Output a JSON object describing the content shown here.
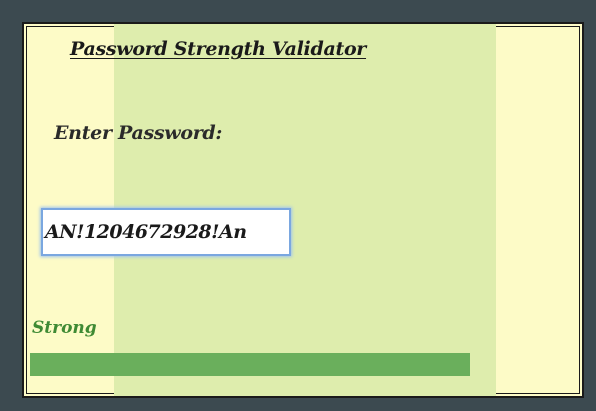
{
  "app": {
    "title": "Password Strength Validator"
  },
  "form": {
    "label": "Enter Password:",
    "password_value": "AN!1204672928!An"
  },
  "strength": {
    "text": "Strong",
    "level_fraction": 1.0,
    "bar_color": "#6aaf5c",
    "text_color": "#3f8a34"
  },
  "colors": {
    "background_outer": "#3c4a50",
    "panel_side": "#fdfbc7",
    "panel_middle": "#deedad",
    "input_focus_border": "#7aa7e0"
  }
}
